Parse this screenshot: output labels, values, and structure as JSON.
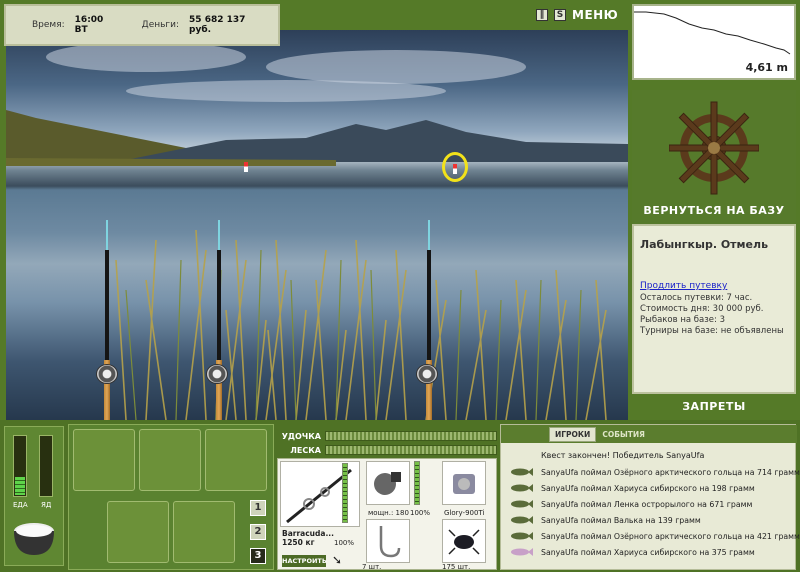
{
  "status": {
    "time_label": "Время:",
    "time_value": "16:00 ВТ",
    "money_label": "Деньги:",
    "money_value": "55 682 137 руб."
  },
  "top_controls": {
    "pause_icon": "pause-icon",
    "sound_icon": "sound-icon",
    "menu_label": "МЕНЮ"
  },
  "depth": {
    "value": "4,61 m"
  },
  "base": {
    "return_label": "ВЕРНУТЬСЯ НА БАЗУ",
    "icon": "ship-wheel-icon"
  },
  "location": {
    "title": "Лабынгкыр. Отмель",
    "extend_link": "Продлить путевку",
    "lines": [
      "Осталось путевки: 7 час.",
      "Стоимость дня: 30 000 руб.",
      "Рыбаков на базе: 3",
      "Турниры на базе: не объявлены"
    ]
  },
  "bans_label": "ЗАПРЕТЫ",
  "meters": {
    "food_label": "ЕДА",
    "poison_label": "ЯД",
    "food_level": 0.3,
    "poison_level": 0
  },
  "inventory": {
    "slots": [
      "tackle-box-icon",
      "groundbait-bag-icon",
      "net-icon",
      "vegetable-basket-icon",
      "bucket-icon"
    ],
    "pages": [
      "1",
      "2",
      "3"
    ],
    "active_page": "3"
  },
  "tackle": {
    "rod_label": "УДОЧКА",
    "line_label": "ЛЕСКА",
    "rod_name": "Barracuda...",
    "rod_weight": "1250 кг",
    "rod_percent": "100%",
    "reel_power": "мощн.: 180",
    "reel_percent": "100%",
    "line_name": "Glory-900Ti",
    "hook_count": "7 шт.",
    "bait_count": "175 шт.",
    "setup_label": "НАСТРОИТЬ"
  },
  "log": {
    "tabs": [
      "ИГРОКИ",
      "СОБЫТИЯ"
    ],
    "active_tab": "ИГРОКИ",
    "first_line": "Квест закончен! Победитель SanyaUfa",
    "entries": [
      "SanyaUfa поймал Озёрного арктического гольца на 714 грамм",
      "SanyaUfa поймал Хариуса сибирского на 198 грамм",
      "SanyaUfa поймал Ленка острорылого на 671 грамм",
      "SanyaUfa поймал Валька на 139 грамм",
      "SanyaUfa поймал Озёрного арктического гольца на 421 грамм",
      "SanyaUfa поймал Хариуса сибирского на 375 грамм"
    ]
  }
}
